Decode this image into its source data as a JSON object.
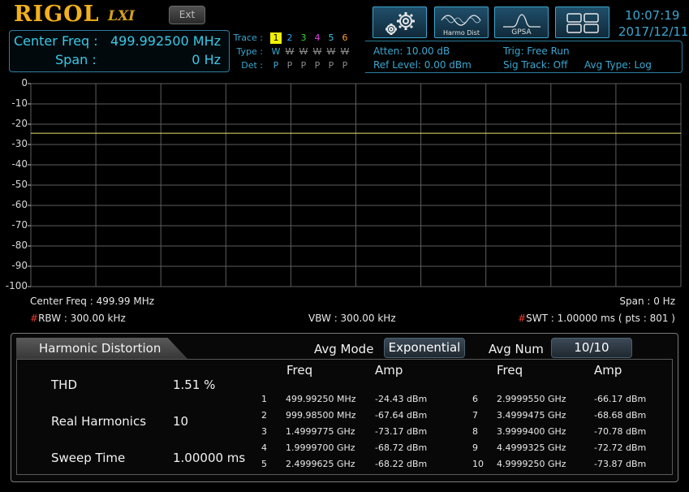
{
  "header": {
    "brand": "RIGOL",
    "brand_sub": "LXI",
    "ext_label": "Ext",
    "mode_buttons": [
      {
        "id": "settings",
        "label": ""
      },
      {
        "id": "harmo-dist",
        "label": "Harmo Dist"
      },
      {
        "id": "gpsa",
        "label": "GPSA"
      },
      {
        "id": "layout",
        "label": ""
      }
    ],
    "time": "10:07:19",
    "date": "2017/12/11",
    "accent_color": "#3aa7cf"
  },
  "measurement": {
    "center_freq_label": "Center Freq :",
    "center_freq_value": "499.992500 MHz",
    "span_label": "Span :",
    "span_value": "0 Hz"
  },
  "traces": {
    "trace_label": "Trace :",
    "type_label": "Type :",
    "det_label": "Det :",
    "numbers": [
      "1",
      "2",
      "3",
      "4",
      "5",
      "6"
    ],
    "colors": [
      "#f2f200",
      "#33a6ff",
      "#33d633",
      "#e83be8",
      "#39c6e6",
      "#ff9933"
    ],
    "types": [
      "W",
      "W",
      "W",
      "W",
      "W",
      "W"
    ],
    "dets": [
      "P",
      "P",
      "P",
      "P",
      "P",
      "P"
    ]
  },
  "status": {
    "atten": "Atten: 10.00 dB",
    "ref_level": "Ref Level: 0.00 dBm",
    "trig": "Trig: Free Run",
    "sig_track": "Sig Track: Off",
    "avg_type": "Avg Type: Log"
  },
  "graph": {
    "y_ticks": [
      "0",
      "-10",
      "-20",
      "-30",
      "-40",
      "-50",
      "-60",
      "-70",
      "-80",
      "-90",
      "-100"
    ],
    "y_range": [
      -100,
      0
    ],
    "trace_level_dbm": -24.43,
    "trace_color": "#e8e070",
    "grid_color": "#5e5e5e",
    "center_freq_info": "Center Freq : 499.99 MHz",
    "span_info": "Span : 0 Hz",
    "rbw_hash": "#",
    "rbw_info": "RBW : 300.00 kHz",
    "vbw_info": "VBW : 300.00 kHz",
    "swt_hash": "#",
    "swt_info": "SWT : 1.00000 ms ( pts : 801 )"
  },
  "harmonic_distortion": {
    "title": "Harmonic Distortion",
    "avg_mode_label": "Avg Mode",
    "avg_mode_value": "Exponential",
    "avg_num_label": "Avg Num",
    "avg_num_value": "10/10",
    "summary": [
      {
        "label": "THD",
        "value": "1.51 %"
      },
      {
        "label": "Real Harmonics",
        "value": "10"
      },
      {
        "label": "Sweep Time",
        "value": "1.00000 ms"
      }
    ],
    "freq_header": "Freq",
    "amp_header": "Amp",
    "left_rows": [
      {
        "n": "1",
        "freq": "499.99250 MHz",
        "amp": "-24.43 dBm"
      },
      {
        "n": "2",
        "freq": "999.98500 MHz",
        "amp": "-67.64 dBm"
      },
      {
        "n": "3",
        "freq": "1.4999775 GHz",
        "amp": "-73.17 dBm"
      },
      {
        "n": "4",
        "freq": "1.9999700 GHz",
        "amp": "-68.72 dBm"
      },
      {
        "n": "5",
        "freq": "2.4999625 GHz",
        "amp": "-68.22 dBm"
      }
    ],
    "right_rows": [
      {
        "n": "6",
        "freq": "2.9999550 GHz",
        "amp": "-66.17 dBm"
      },
      {
        "n": "7",
        "freq": "3.4999475 GHz",
        "amp": "-68.68 dBm"
      },
      {
        "n": "8",
        "freq": "3.9999400 GHz",
        "amp": "-70.78 dBm"
      },
      {
        "n": "9",
        "freq": "4.4999325 GHz",
        "amp": "-72.72 dBm"
      },
      {
        "n": "10",
        "freq": "4.9999250 GHz",
        "amp": "-73.87 dBm"
      }
    ]
  }
}
